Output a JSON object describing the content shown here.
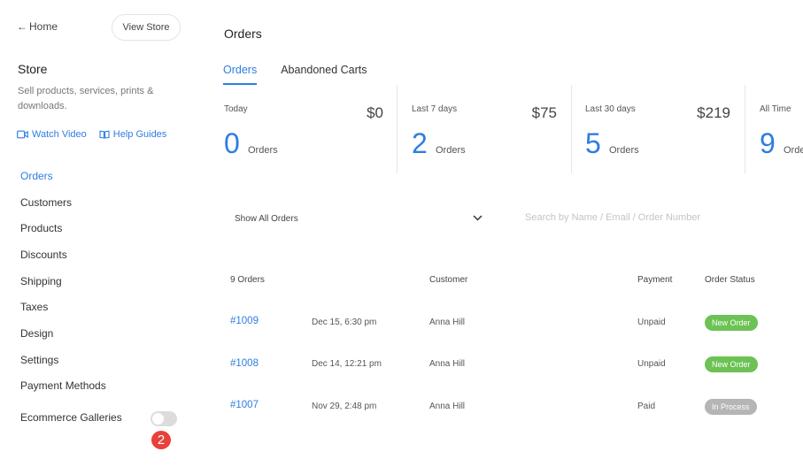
{
  "sidebar": {
    "home_label": "Home",
    "view_store_label": "View Store",
    "store_title": "Store",
    "store_description": "Sell products, services, prints & downloads.",
    "watch_video_label": "Watch Video",
    "help_guides_label": "Help Guides",
    "nav_items": [
      {
        "label": "Orders",
        "active": true
      },
      {
        "label": "Customers"
      },
      {
        "label": "Products"
      },
      {
        "label": "Discounts"
      },
      {
        "label": "Shipping"
      },
      {
        "label": "Taxes"
      },
      {
        "label": "Design"
      },
      {
        "label": "Settings"
      },
      {
        "label": "Payment Methods"
      }
    ],
    "galleries_label": "Ecommerce Galleries",
    "galleries_enabled": false,
    "notification_count": "2"
  },
  "main": {
    "title": "Orders",
    "tabs": [
      {
        "label": "Orders",
        "active": true
      },
      {
        "label": "Abandoned Carts"
      }
    ],
    "stats": [
      {
        "label": "Today",
        "amount": "$0",
        "count": "0",
        "unit": "Orders"
      },
      {
        "label": "Last 7 days",
        "amount": "$75",
        "count": "2",
        "unit": "Orders"
      },
      {
        "label": "Last 30 days",
        "amount": "$219",
        "count": "5",
        "unit": "Orders"
      },
      {
        "label": "All Time",
        "amount": "",
        "count": "9",
        "unit": "Orders"
      }
    ],
    "filter_label": "Show All Orders",
    "search_placeholder": "Search by Name / Email / Order Number",
    "table": {
      "headers": {
        "orders": "9 Orders",
        "customer": "Customer",
        "payment": "Payment",
        "status": "Order Status"
      },
      "rows": [
        {
          "id": "#1009",
          "date": "Dec 15, 6:30 pm",
          "customer": "Anna Hill",
          "payment": "Unpaid",
          "status": "New Order"
        },
        {
          "id": "#1008",
          "date": "Dec 14, 12:21 pm",
          "customer": "Anna Hill",
          "payment": "Unpaid",
          "status": "New Order"
        },
        {
          "id": "#1007",
          "date": "Nov 29, 2:48 pm",
          "customer": "Anna Hill",
          "payment": "Paid",
          "status": "In Process"
        }
      ]
    }
  },
  "colors": {
    "accent": "#2f7de1",
    "new_order": "#6cc254",
    "in_process": "#b5b5b5",
    "badge": "#e8403a"
  }
}
